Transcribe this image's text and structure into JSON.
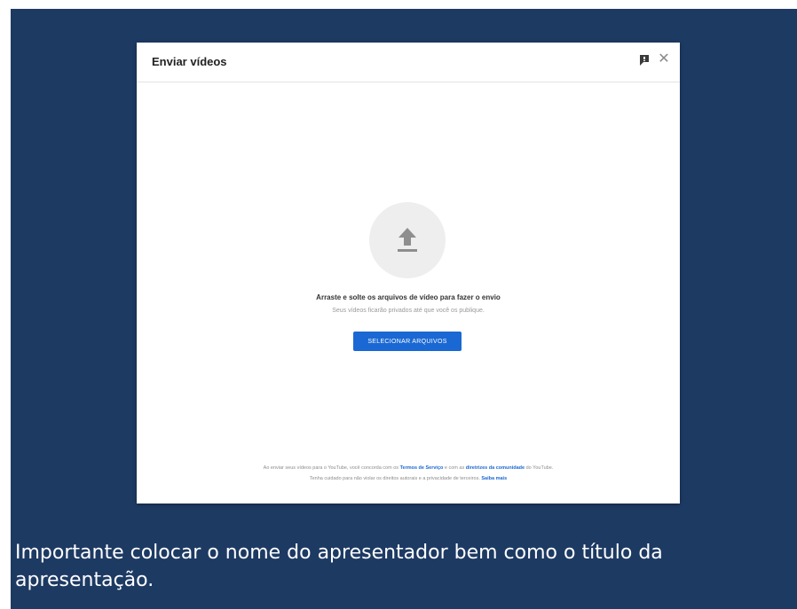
{
  "dialog": {
    "title": "Enviar vídeos",
    "feedback_icon": "feedback-flag-icon",
    "close_icon": "close-icon",
    "close_glyph": "✕",
    "upload_icon": "upload-arrow-icon",
    "drop_prompt": "Arraste e solte os arquivos de vídeo para fazer o envio",
    "privacy_note": "Seus vídeos ficarão privados até que você os publique.",
    "select_button_label": "SELECIONAR ARQUIVOS",
    "footer": {
      "line1_prefix": "Ao enviar seus vídeos para o YouTube, você concorda com os",
      "terms_link": "Termos de Serviço",
      "line1_middle": "e com as",
      "guidelines_link": "diretrizes da comunidade",
      "line1_suffix": "do YouTube.",
      "line2_text": "Tenha cuidado para não violar os direitos autorais e a privacidade de terceiros.",
      "learn_more_link": "Saiba mais"
    }
  },
  "caption": "Importante colocar o nome do apresentador bem como o título da apresentação.",
  "colors": {
    "slide_background": "#1d3a63",
    "accent_blue": "#1a68d3"
  }
}
